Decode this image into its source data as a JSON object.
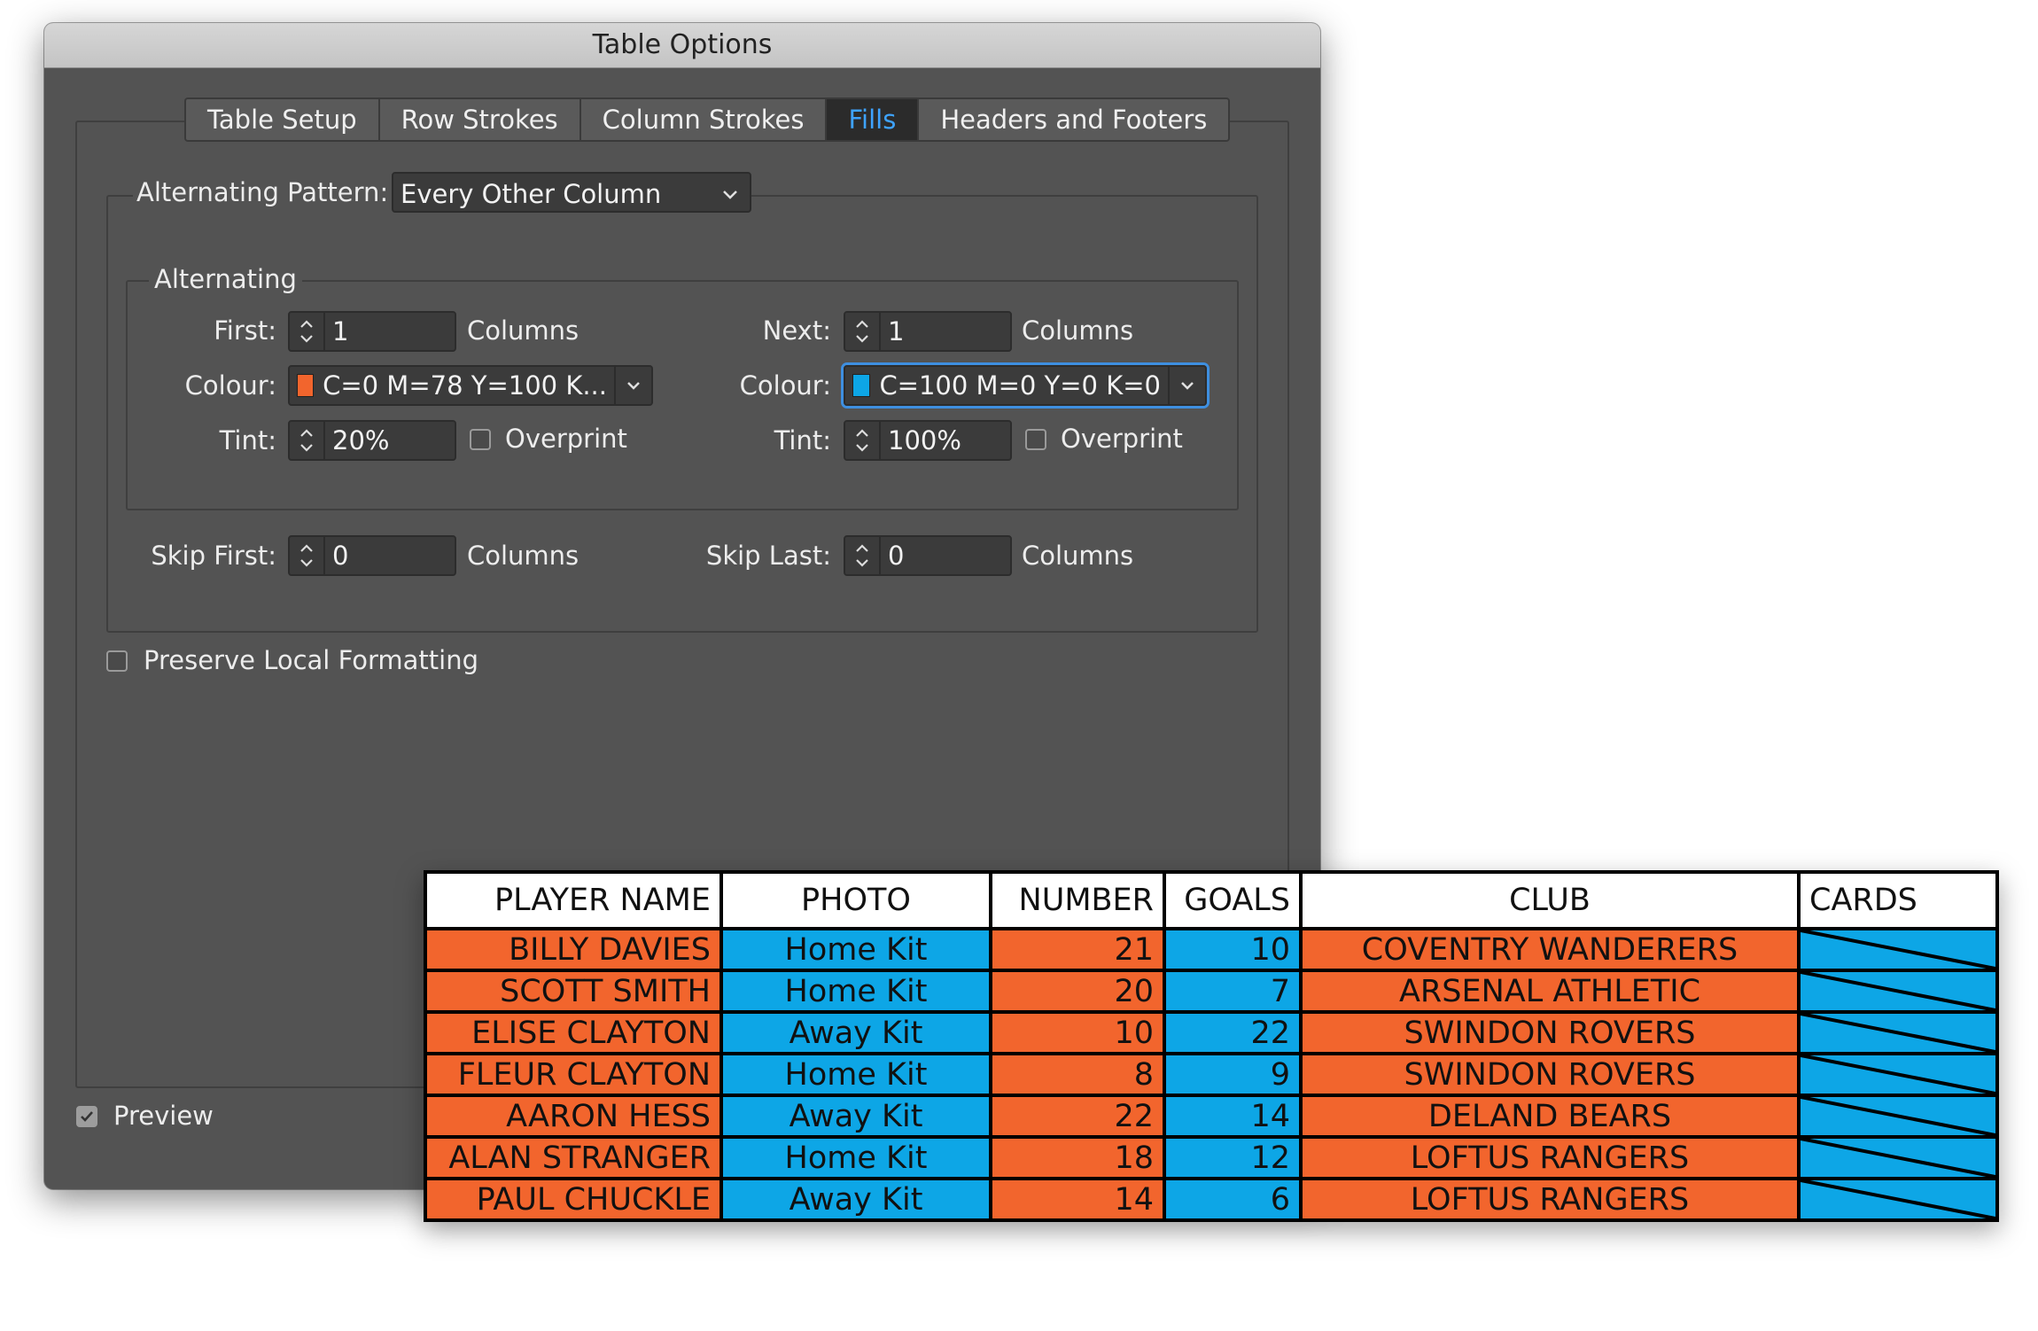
{
  "dialog": {
    "title": "Table Options",
    "tabs": [
      {
        "label": "Table Setup",
        "active": false
      },
      {
        "label": "Row Strokes",
        "active": false
      },
      {
        "label": "Column Strokes",
        "active": false
      },
      {
        "label": "Fills",
        "active": true
      },
      {
        "label": "Headers and Footers",
        "active": false
      }
    ],
    "pattern_label": "Alternating Pattern:",
    "pattern_value": "Every Other Column",
    "alternating_title": "Alternating",
    "first": {
      "label": "First:",
      "value": "1",
      "unit": "Columns"
    },
    "next": {
      "label": "Next:",
      "value": "1",
      "unit": "Columns"
    },
    "colour_first": {
      "label": "Colour:",
      "value": "C=0 M=78 Y=100 K...",
      "swatch": "#f2652d"
    },
    "colour_next": {
      "label": "Colour:",
      "value": "C=100 M=0 Y=0 K=0",
      "swatch": "#0da6e6"
    },
    "tint_first": {
      "label": "Tint:",
      "value": "20%",
      "overprint": "Overprint",
      "overprint_checked": false
    },
    "tint_next": {
      "label": "Tint:",
      "value": "100%",
      "overprint": "Overprint",
      "overprint_checked": false
    },
    "skip_first": {
      "label": "Skip First:",
      "value": "0",
      "unit": "Columns"
    },
    "skip_last": {
      "label": "Skip Last:",
      "value": "0",
      "unit": "Columns"
    },
    "preserve": {
      "label": "Preserve Local Formatting",
      "checked": false
    },
    "preview": {
      "label": "Preview",
      "checked": true
    }
  },
  "table": {
    "headers": {
      "name": "PLAYER NAME",
      "photo": "PHOTO",
      "number": "NUMBER",
      "goals": "GOALS",
      "club": "CLUB",
      "cards": "CARDS"
    },
    "rows": [
      {
        "name": "BILLY DAVIES",
        "photo": "Home Kit",
        "number": "21",
        "goals": "10",
        "club": "COVENTRY WANDERERS"
      },
      {
        "name": "SCOTT SMITH",
        "photo": "Home Kit",
        "number": "20",
        "goals": "7",
        "club": "ARSENAL ATHLETIC"
      },
      {
        "name": "ELISE CLAYTON",
        "photo": "Away Kit",
        "number": "10",
        "goals": "22",
        "club": "SWINDON ROVERS"
      },
      {
        "name": "FLEUR CLAYTON",
        "photo": "Home Kit",
        "number": "8",
        "goals": "9",
        "club": "SWINDON ROVERS"
      },
      {
        "name": "AARON HESS",
        "photo": "Away Kit",
        "number": "22",
        "goals": "14",
        "club": "DELAND BEARS"
      },
      {
        "name": "ALAN STRANGER",
        "photo": "Home Kit",
        "number": "18",
        "goals": "12",
        "club": "LOFTUS RANGERS"
      },
      {
        "name": "PAUL CHUCKLE",
        "photo": "Away Kit",
        "number": "14",
        "goals": "6",
        "club": "LOFTUS RANGERS"
      }
    ],
    "colors": {
      "fill_first": "#f2652d",
      "fill_next": "#0da6e6"
    }
  }
}
